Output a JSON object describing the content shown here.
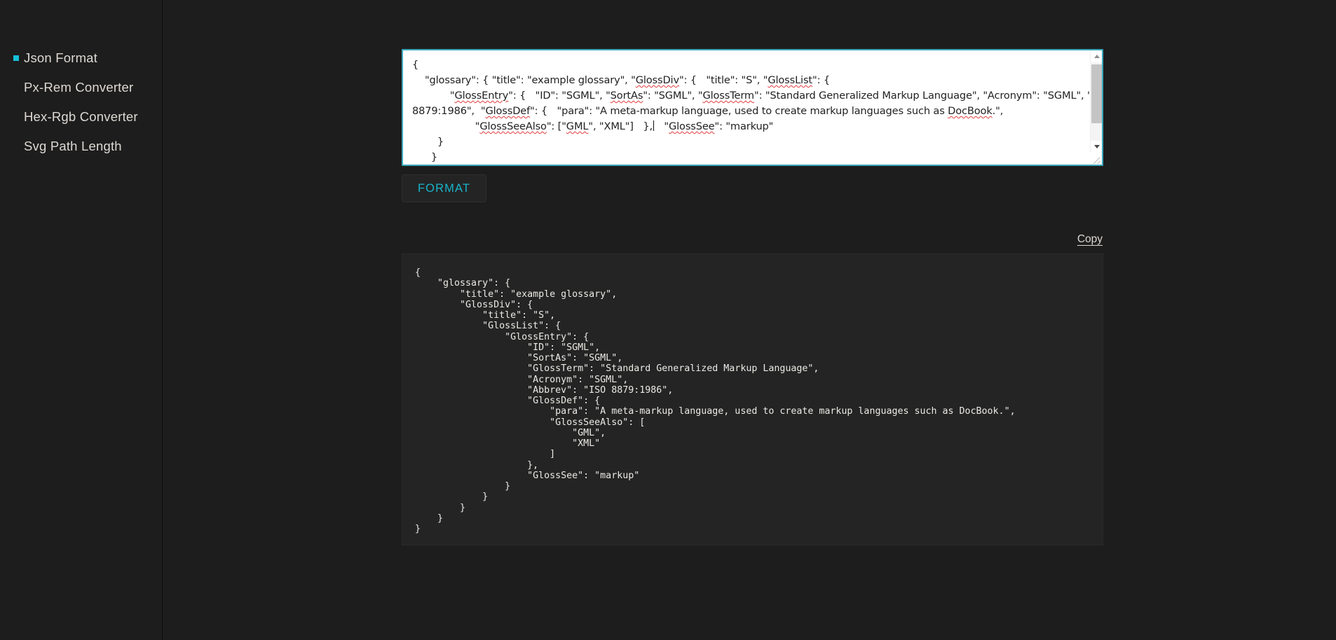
{
  "sidebar": {
    "items": [
      {
        "label": "Json Format",
        "active": true,
        "name": "sidebar-item-json-format"
      },
      {
        "label": "Px-Rem Converter",
        "active": false,
        "name": "sidebar-item-px-rem-converter"
      },
      {
        "label": "Hex-Rgb Converter",
        "active": false,
        "name": "sidebar-item-hex-rgb-converter"
      },
      {
        "label": "Svg Path Length",
        "active": false,
        "name": "sidebar-item-svg-path-length"
      }
    ]
  },
  "editor": {
    "lines": [
      "{",
      "    \"glossary\": { \"title\": \"example glossary\", \"GlossDiv\": {   \"title\": \"S\", \"GlossList\": {",
      "            \"GlossEntry\": {   \"ID\": \"SGML\", \"SortAs\": \"SGML\", \"GlossTerm\": \"Standard Generalized Markup Language\", \"Acronym\": \"SGML\", \"Abbrev\": \"ISO",
      "8879:1986\",  \"GlossDef\": {   \"para\": \"A meta-markup language, used to create markup languages such as DocBook.\",",
      "                    \"GlossSeeAlso\": [\"GML\", \"XML\"]   },    \"GlossSee\": \"markup\"",
      "        }",
      "      }",
      "    }"
    ],
    "scroll_position": "top"
  },
  "buttons": {
    "format_label": "FORMAT",
    "copy_label": "Copy"
  },
  "output": {
    "text": "{\n    \"glossary\": {\n        \"title\": \"example glossary\",\n        \"GlossDiv\": {\n            \"title\": \"S\",\n            \"GlossList\": {\n                \"GlossEntry\": {\n                    \"ID\": \"SGML\",\n                    \"SortAs\": \"SGML\",\n                    \"GlossTerm\": \"Standard Generalized Markup Language\",\n                    \"Acronym\": \"SGML\",\n                    \"Abbrev\": \"ISO 8879:1986\",\n                    \"GlossDef\": {\n                        \"para\": \"A meta-markup language, used to create markup languages such as DocBook.\",\n                        \"GlossSeeAlso\": [\n                            \"GML\",\n                            \"XML\"\n                        ]\n                    },\n                    \"GlossSee\": \"markup\"\n                }\n            }\n        }\n    }\n}"
  },
  "colors": {
    "accent": "#16c0d8",
    "page_background": "#1d1d1d",
    "panel_background": "#242424",
    "text": "#ded9d4",
    "editor_background": "#ffffff",
    "editor_border": "#3aa9bd"
  }
}
